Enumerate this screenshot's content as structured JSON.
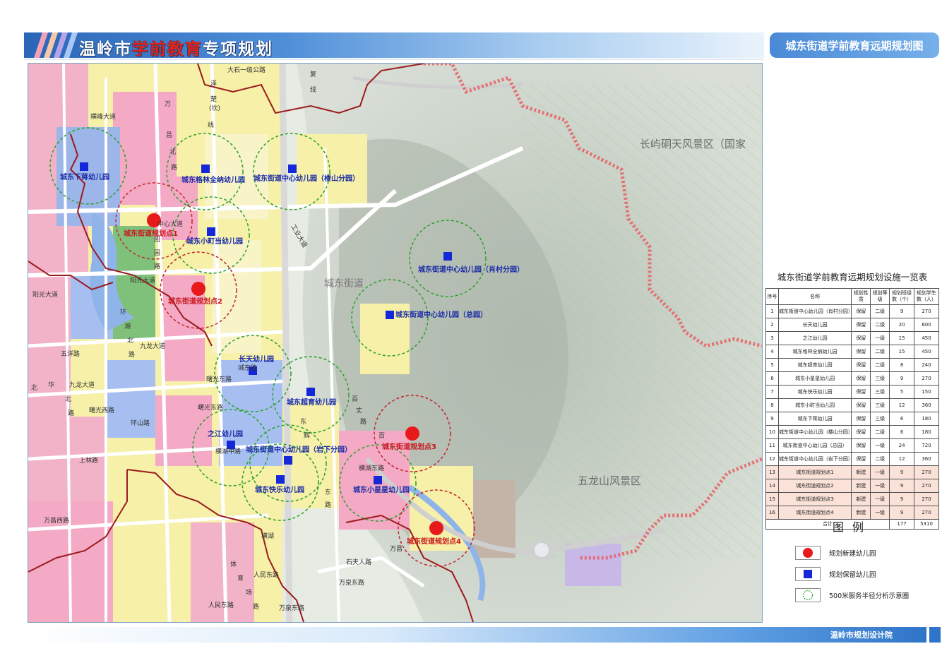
{
  "header": {
    "title_part1": "温岭市",
    "title_part2": "学前教育",
    "title_part3": "专项规划",
    "subtitle": "城东街道学前教育远期规划图"
  },
  "map": {
    "place_labels": {
      "scenic_north": "长屿硐天风景区（国家",
      "scenic_south": "五龙山风景区",
      "district": "城东街道"
    },
    "road_labels": {
      "r1": "大石一级公路",
      "r2": "横峰大道",
      "r3": "泽",
      "r4": "楚",
      "r5": "(坎)",
      "r6": "线",
      "r7": "复",
      "r8": "线",
      "r9": "万",
      "r10": "昌",
      "r11": "北",
      "r12": "路",
      "r13": "中心大道",
      "r14": "田",
      "r15": "园",
      "r16": "路",
      "r17": "阳光大道",
      "r18": "环",
      "r19": "湖",
      "r20": "北",
      "r21": "路",
      "r22": "九龙大道",
      "r23": "五洋路",
      "r24": "北",
      "r25": "华",
      "r26": "北",
      "r27": "路",
      "r28": "九龙大道",
      "r29": "曙光西路",
      "r30": "环山路",
      "r31": "上林路",
      "r32": "万昌西路",
      "r33": "曙光东路",
      "r34": "横湖中路",
      "r35": "横湖东路",
      "r36": "东",
      "r37": "辉",
      "r38": "百",
      "r39": "丈",
      "r40": "路",
      "r41": "万昌",
      "r42": "石夫人路",
      "r43": "人民东路",
      "r44": "万泉东路",
      "r45": "人民东路",
      "r46": "万泉东路",
      "r47": "体",
      "r48": "育",
      "r49": "场",
      "r50": "路",
      "r51": "城东路",
      "r52": "横湖",
      "r53": "东",
      "r54": "路",
      "r55": "阳光大道",
      "r56": "曙光东路",
      "r57": "工业大道",
      "r58": "百"
    },
    "kindergartens": [
      {
        "name": "城东下蒋幼儿园",
        "type": "retained"
      },
      {
        "name": "城东格林全纳幼儿园",
        "type": "retained"
      },
      {
        "name": "城东街道中心幼儿园（楼山分园）",
        "type": "retained"
      },
      {
        "name": "城东街道规划点1",
        "type": "new"
      },
      {
        "name": "城东小町当幼儿园",
        "type": "retained"
      },
      {
        "name": "城东街道规划点2",
        "type": "new"
      },
      {
        "name": "城东街道中心幼儿园（肖村分园）",
        "type": "retained"
      },
      {
        "name": "城东街道中心幼儿园（总园）",
        "type": "retained"
      },
      {
        "name": "长天幼儿园",
        "type": "retained"
      },
      {
        "name": "城东超育幼儿园",
        "type": "retained"
      },
      {
        "name": "之江幼儿园",
        "type": "retained"
      },
      {
        "name": "城东街道中心幼儿园（岩下分园）",
        "type": "retained"
      },
      {
        "name": "城东街道规划点3",
        "type": "new"
      },
      {
        "name": "城东快乐幼儿园",
        "type": "retained"
      },
      {
        "name": "城东小星星幼儿园",
        "type": "retained"
      },
      {
        "name": "城东街道规划点4",
        "type": "new"
      }
    ],
    "colors": {
      "new": "#e8191a",
      "retained": "#1428d8",
      "buffer": "#2aa02a",
      "boundary": "#9c1b1e"
    }
  },
  "table": {
    "title": "城东街道学前教育远期规划设施一览表",
    "headers": [
      "序号",
      "名称",
      "规划性质",
      "规划等级",
      "规划班级数（个）",
      "规划学生数（人）"
    ],
    "rows": [
      {
        "no": "1",
        "name": "城东街道中心幼儿园（肖村分园）",
        "nature": "保留",
        "grade": "二级",
        "classes": "9",
        "students": "270"
      },
      {
        "no": "2",
        "name": "长天幼儿园",
        "nature": "保留",
        "grade": "二级",
        "classes": "20",
        "students": "600"
      },
      {
        "no": "3",
        "name": "之江幼儿园",
        "nature": "保留",
        "grade": "一级",
        "classes": "15",
        "students": "450"
      },
      {
        "no": "4",
        "name": "城东格林全纳幼儿园",
        "nature": "保留",
        "grade": "二级",
        "classes": "15",
        "students": "450"
      },
      {
        "no": "5",
        "name": "城东超育幼儿园",
        "nature": "保留",
        "grade": "二级",
        "classes": "8",
        "students": "240"
      },
      {
        "no": "6",
        "name": "城东小星星幼儿园",
        "nature": "保留",
        "grade": "三级",
        "classes": "9",
        "students": "270"
      },
      {
        "no": "7",
        "name": "城东快乐幼儿园",
        "nature": "保留",
        "grade": "三级",
        "classes": "5",
        "students": "150"
      },
      {
        "no": "8",
        "name": "城东小町当幼儿园",
        "nature": "保留",
        "grade": "三级",
        "classes": "12",
        "students": "360"
      },
      {
        "no": "9",
        "name": "城东下蒋幼儿园",
        "nature": "保留",
        "grade": "三级",
        "classes": "6",
        "students": "180"
      },
      {
        "no": "10",
        "name": "城东街道中心幼儿园（楼山分园）",
        "nature": "保留",
        "grade": "二级",
        "classes": "6",
        "students": "180"
      },
      {
        "no": "11",
        "name": "城东街道中心幼儿园（总园）",
        "nature": "保留",
        "grade": "一级",
        "classes": "24",
        "students": "720"
      },
      {
        "no": "12",
        "name": "城东街道中心幼儿园（岩下分园）",
        "nature": "保留",
        "grade": "二级",
        "classes": "12",
        "students": "360"
      },
      {
        "no": "13",
        "name": "城东街道规划点1",
        "nature": "新建",
        "grade": "一级",
        "classes": "9",
        "students": "270"
      },
      {
        "no": "14",
        "name": "城东街道规划点2",
        "nature": "新建",
        "grade": "一级",
        "classes": "9",
        "students": "270"
      },
      {
        "no": "15",
        "name": "城东街道规划点3",
        "nature": "新建",
        "grade": "一级",
        "classes": "9",
        "students": "270"
      },
      {
        "no": "16",
        "name": "城东街道规划点4",
        "nature": "新建",
        "grade": "一级",
        "classes": "9",
        "students": "270"
      }
    ],
    "total": {
      "label": "合计",
      "classes": "177",
      "students": "5310"
    }
  },
  "legend": {
    "title": "图例",
    "items": [
      {
        "label": "规划新建幼儿园",
        "icon": "red-dot"
      },
      {
        "label": "规划保留幼儿园",
        "icon": "blue-square"
      },
      {
        "label": "500米服务半径分析示意圈",
        "icon": "green-dashed-circle"
      }
    ]
  },
  "footer": {
    "org": "温岭市规划设计院"
  }
}
